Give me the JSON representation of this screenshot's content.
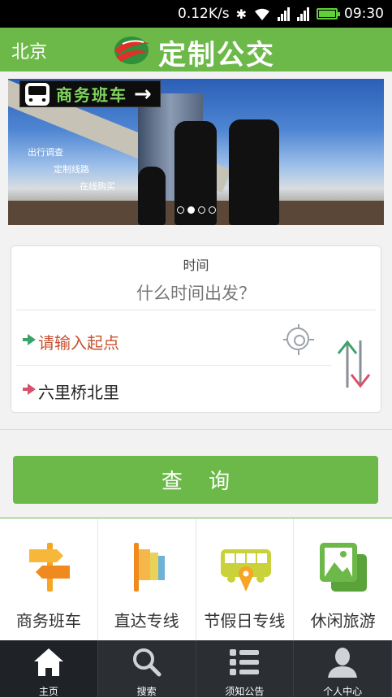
{
  "status_bar": {
    "speed": "0.12K/s",
    "time": "09:30"
  },
  "header": {
    "city": "北京",
    "title": "定制公交"
  },
  "banner": {
    "tag": "商务班车",
    "lines": [
      "出行调查",
      "定制线路",
      "在线购买"
    ],
    "dots": 4,
    "active_dot": 2
  },
  "search": {
    "time_label": "时间",
    "time_hint": "什么时间出发？",
    "start_placeholder": "请输入起点",
    "end_value": "六里桥北里"
  },
  "query_button": "查 询",
  "categories": [
    {
      "label": "商务班车",
      "icon": "signpost-icon",
      "color": "#f5a623"
    },
    {
      "label": "直达专线",
      "icon": "flag-icon",
      "color": "#e8a13a"
    },
    {
      "label": "节假日专线",
      "icon": "bus-location-icon",
      "color": "#c9d23a"
    },
    {
      "label": "休闲旅游",
      "icon": "photo-icon",
      "color": "#6cb949"
    }
  ],
  "tabs": [
    {
      "label": "主页",
      "icon": "home-icon",
      "active": true
    },
    {
      "label": "搜索",
      "icon": "search-icon",
      "active": false
    },
    {
      "label": "须知公告",
      "icon": "list-icon",
      "active": false
    },
    {
      "label": "个人中心",
      "icon": "user-icon",
      "active": false
    }
  ],
  "colors": {
    "brand_green": "#6cb949",
    "start_red": "#c8502f"
  }
}
